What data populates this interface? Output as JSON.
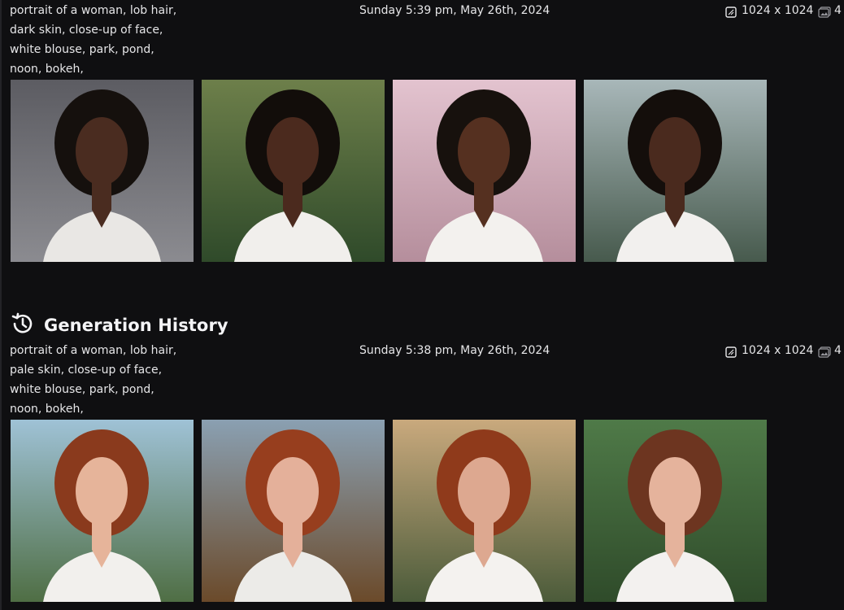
{
  "history": {
    "title": "Generation History"
  },
  "generations": [
    {
      "prompt": "portrait of a woman, lob hair, dark skin, close-up of face, white blouse, park, pond, noon, bokeh,",
      "timestamp": "Sunday 5:39 pm, May 26th, 2024",
      "dimensions": "1024 x 1024",
      "image_count": "4",
      "images": [
        {
          "name": "generated-image-1-1",
          "skin": "#4a2c20",
          "hair": "#15100d",
          "bg_top": "#5c5c62",
          "bg_bottom": "#8b8b90",
          "shirt": "#e9e7e4"
        },
        {
          "name": "generated-image-1-2",
          "skin": "#4b2a1e",
          "hair": "#120d0a",
          "bg_top": "#6d7f4a",
          "bg_bottom": "#2f4a2a",
          "shirt": "#f1efec"
        },
        {
          "name": "generated-image-1-3",
          "skin": "#553020",
          "hair": "#17110d",
          "bg_top": "#e3c3cf",
          "bg_bottom": "#b58e9c",
          "shirt": "#f3f1ee"
        },
        {
          "name": "generated-image-1-4",
          "skin": "#4a2a1e",
          "hair": "#140e0b",
          "bg_top": "#a8b7b9",
          "bg_bottom": "#475a4d",
          "shirt": "#f2f0ee"
        }
      ]
    },
    {
      "prompt": "portrait of a woman, lob hair, pale skin, close-up of face, white blouse, park, pond, noon, bokeh,",
      "timestamp": "Sunday 5:38 pm, May 26th, 2024",
      "dimensions": "1024 x 1024",
      "image_count": "4",
      "images": [
        {
          "name": "generated-image-2-1",
          "skin": "#e6b49a",
          "hair": "#8a3a1d",
          "bg_top": "#9fc2d6",
          "bg_bottom": "#4f6e44",
          "shirt": "#f2f0ed"
        },
        {
          "name": "generated-image-2-2",
          "skin": "#e4b09a",
          "hair": "#973e1e",
          "bg_top": "#8aa0b2",
          "bg_bottom": "#6b4a2a",
          "shirt": "#ecebe8"
        },
        {
          "name": "generated-image-2-3",
          "skin": "#dda890",
          "hair": "#8f3a1b",
          "bg_top": "#c9a97d",
          "bg_bottom": "#4b5b3a",
          "shirt": "#f4f2ef"
        },
        {
          "name": "generated-image-2-4",
          "skin": "#e5b39c",
          "hair": "#6d3520",
          "bg_top": "#4f7a48",
          "bg_bottom": "#2f4b2a",
          "shirt": "#f3f1ef"
        }
      ]
    }
  ]
}
